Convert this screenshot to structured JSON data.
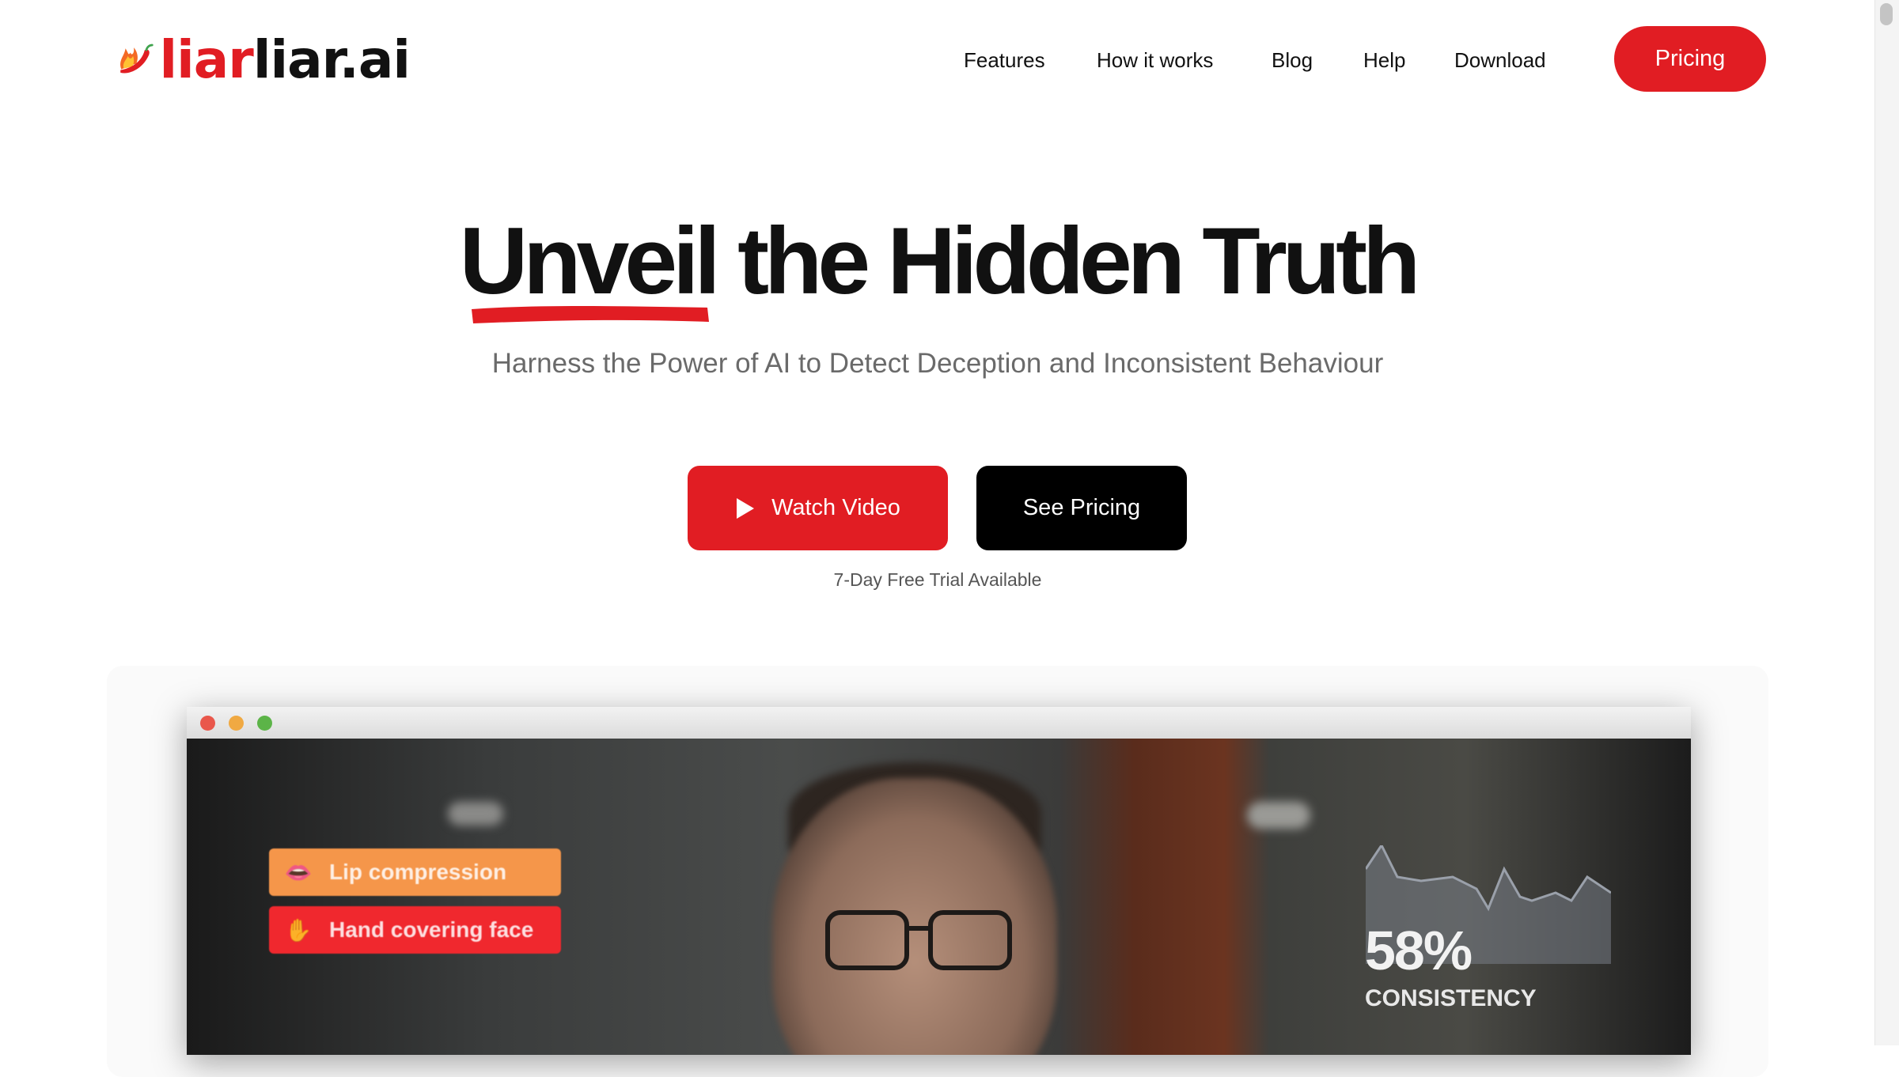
{
  "brand": {
    "name_part1": "liar",
    "name_part2": "liar.ai",
    "accent": "#e11d23"
  },
  "nav": {
    "items": [
      {
        "label": "Features"
      },
      {
        "label": "How it works"
      },
      {
        "label": "Blog"
      },
      {
        "label": "Help"
      },
      {
        "label": "Download"
      }
    ],
    "pricing_label": "Pricing"
  },
  "hero": {
    "title_highlight": "Unveil",
    "title_rest": "the Hidden Truth",
    "subtitle": "Harness the Power of AI to Detect Deception and Inconsistent Behaviour",
    "watch_label": "Watch Video",
    "see_pricing_label": "See Pricing",
    "trial_note": "7-Day Free Trial Available"
  },
  "demo": {
    "tags": [
      {
        "label": "Lip compression",
        "icon": "lips-icon",
        "color": "#f5964a"
      },
      {
        "label": "Hand covering face",
        "icon": "hand-icon",
        "color": "#f0282e"
      }
    ],
    "consistency_value": "58%",
    "consistency_label": "CONSISTENCY"
  }
}
